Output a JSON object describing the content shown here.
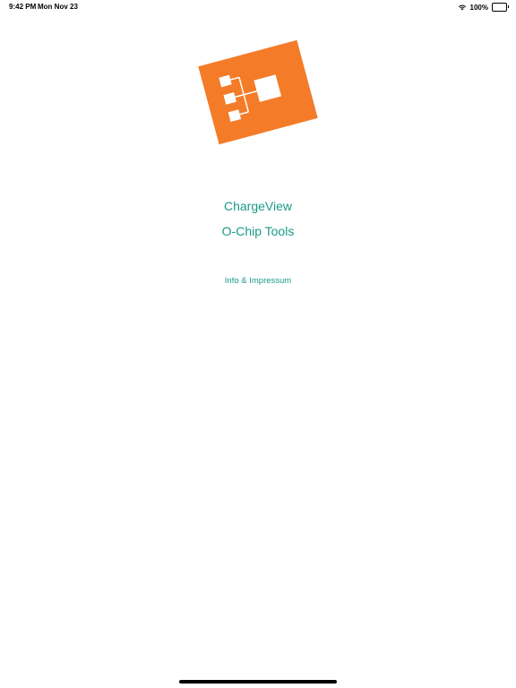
{
  "status_bar": {
    "time": "9:42 PM",
    "date": "Mon Nov 23",
    "battery_text": "100%",
    "battery_level": 1.0,
    "wifi_icon": "wifi-icon",
    "battery_icon": "battery-icon"
  },
  "logo": {
    "icon": "hierarchy-diagram-icon",
    "background_color": "#F47B28",
    "foreground_color": "#FFFFFF"
  },
  "menu": {
    "items": [
      {
        "label": "ChargeView"
      },
      {
        "label": "O-Chip Tools"
      },
      {
        "label": "Info & Impressum"
      }
    ],
    "link_color": "#1A9A8A"
  },
  "colors": {
    "background": "#FFFFFF",
    "accent": "#1A9A8A",
    "logo_orange": "#F47B28"
  }
}
